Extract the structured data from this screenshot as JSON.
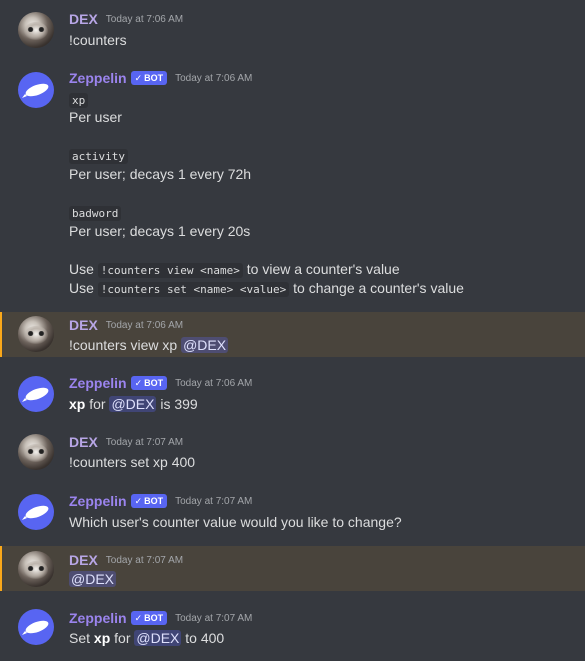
{
  "messages": [
    {
      "user": "DEX",
      "time": "Today at 7:06 AM",
      "text": "!counters"
    },
    {
      "user": "Zeppelin",
      "bot_tag": "BOT",
      "time": "Today at 7:06 AM",
      "counters": [
        {
          "name": "xp",
          "desc": "Per user"
        },
        {
          "name": "activity",
          "desc": "Per user; decays 1 every 72h"
        },
        {
          "name": "badword",
          "desc": "Per user; decays 1 every 20s"
        }
      ],
      "usage": [
        {
          "prefix": "Use",
          "code": "!counters view <name>",
          "suffix": "to view a counter's value"
        },
        {
          "prefix": "Use",
          "code": "!counters set <name> <value>",
          "suffix": "to change a counter's value"
        }
      ]
    },
    {
      "user": "DEX",
      "time": "Today at 7:06 AM",
      "text": "!counters view xp",
      "mention": "@DEX"
    },
    {
      "user": "Zeppelin",
      "bot_tag": "BOT",
      "time": "Today at 7:06 AM",
      "bold": "xp",
      "mid": "for",
      "mention": "@DEX",
      "after": "is 399"
    },
    {
      "user": "DEX",
      "time": "Today at 7:07 AM",
      "text": "!counters set xp 400"
    },
    {
      "user": "Zeppelin",
      "bot_tag": "BOT",
      "time": "Today at 7:07 AM",
      "text": "Which user's counter value would you like to change?"
    },
    {
      "user": "DEX",
      "time": "Today at 7:07 AM",
      "mention": "@DEX"
    },
    {
      "user": "Zeppelin",
      "bot_tag": "BOT",
      "time": "Today at 7:07 AM",
      "pre": "Set",
      "bold": "xp",
      "mid": "for",
      "mention": "@DEX",
      "after": "to 400"
    }
  ]
}
